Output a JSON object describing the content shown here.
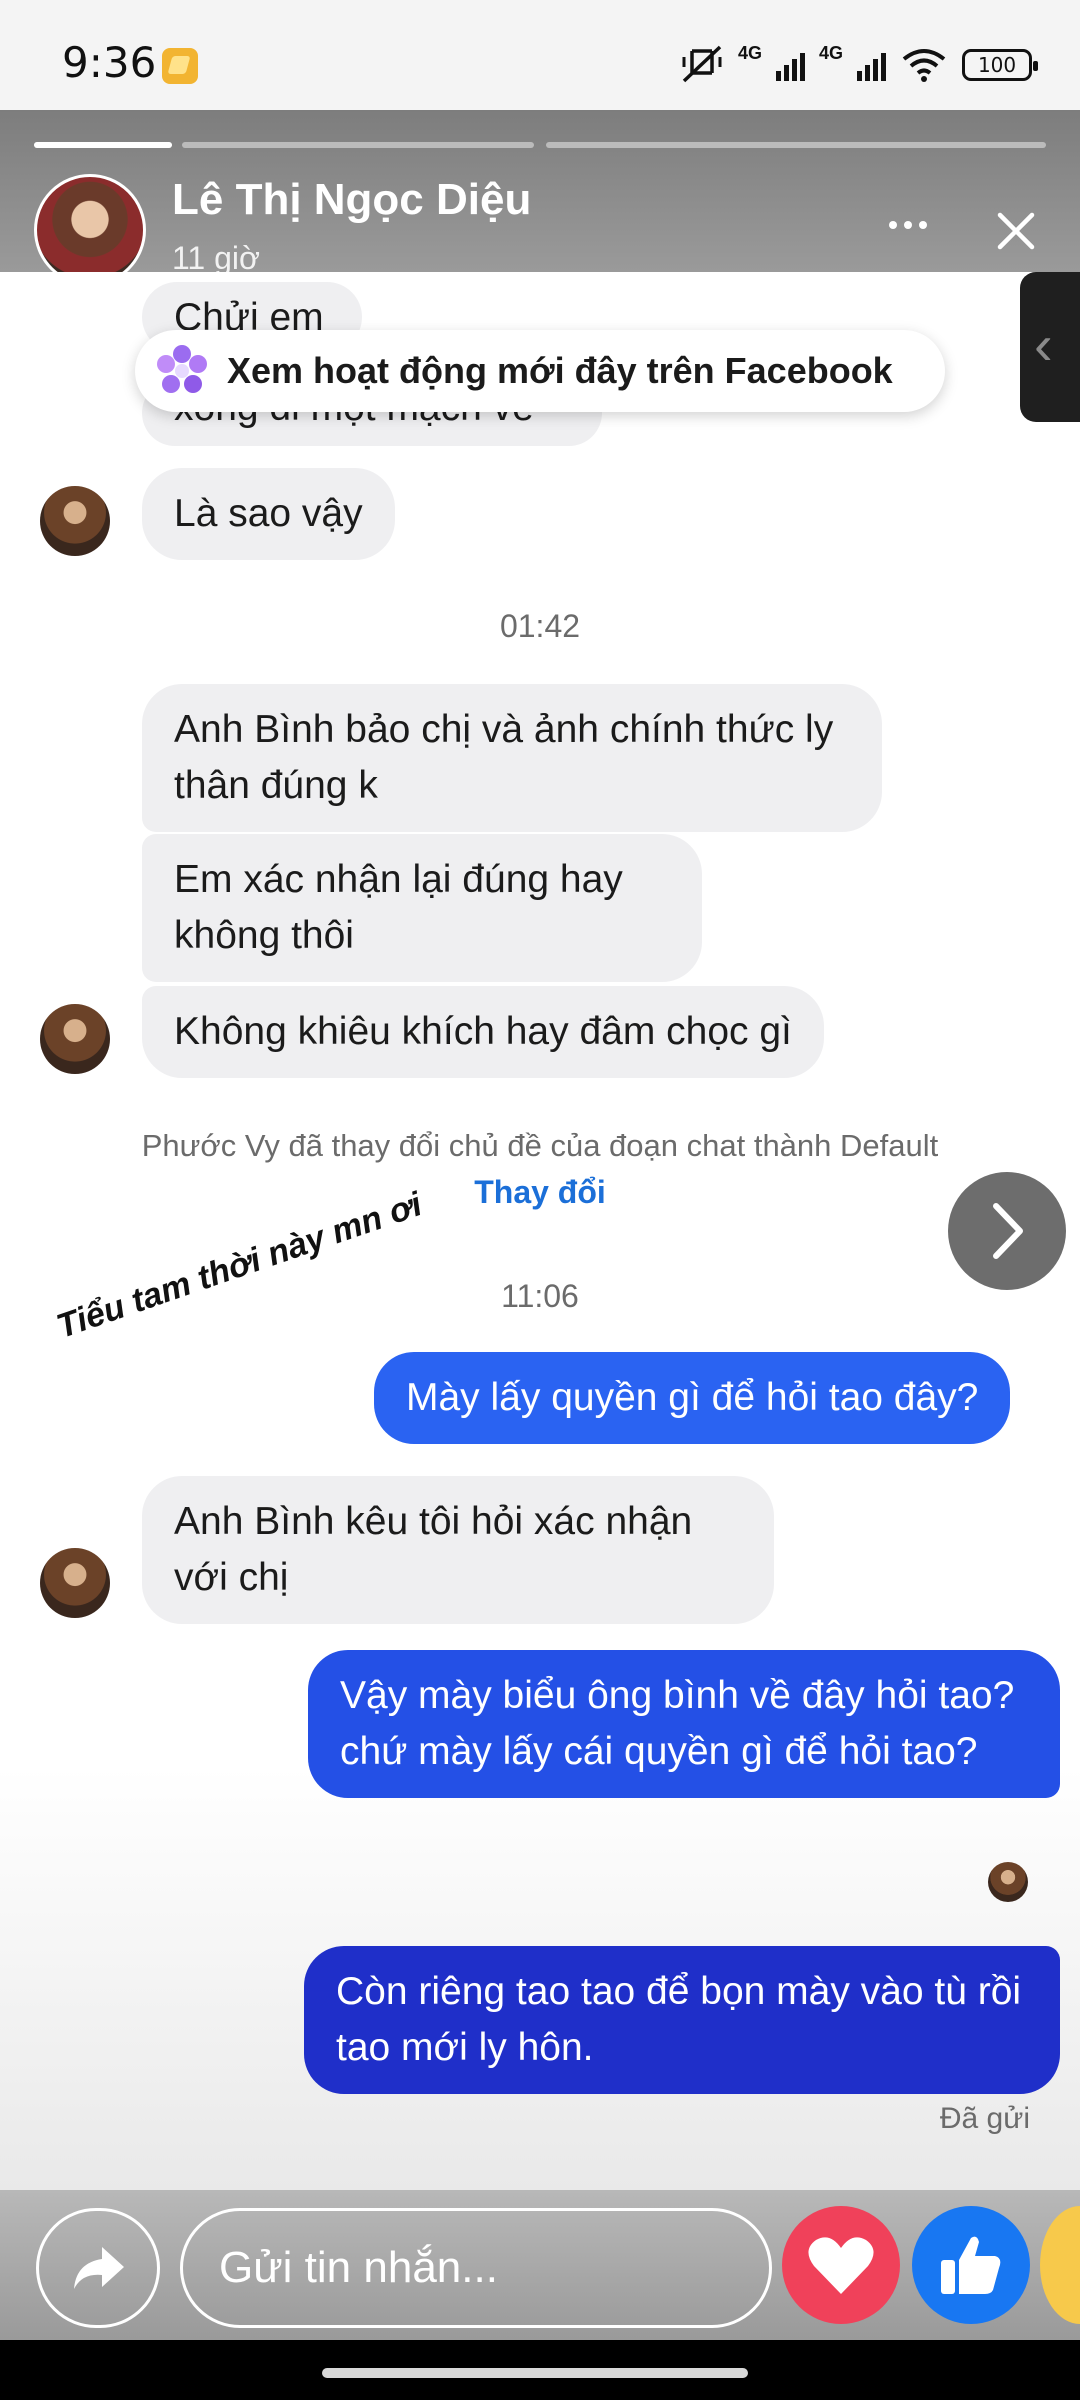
{
  "status_bar": {
    "time": "9:36",
    "network_1": "4G",
    "network_2": "4G",
    "battery": "100"
  },
  "story": {
    "name": "Lê Thị Ngọc Diệu",
    "time": "11 giờ",
    "progress": [
      1.0,
      0.0,
      0.0
    ]
  },
  "banner": {
    "text": "Xem hoạt động mới đây trên Facebook"
  },
  "chat": {
    "partial_1": "Chửi em",
    "partial_2": "xong đi một mạch về",
    "msg_1": "Là sao vậy",
    "time_1": "01:42",
    "msg_2": "Anh Bình bảo chị và ảnh chính thức ly thân đúng k",
    "msg_3": "Em xác nhận lại đúng hay không thôi",
    "msg_4": "Không khiêu khích hay đâm chọc gì",
    "system_note": "Phước Vy đã thay đổi chủ đề của đoạn chat thành Default",
    "system_link": "Thay đổi",
    "time_2": "11:06",
    "msg_5": "Mày lấy quyền gì để hỏi tao đây?",
    "msg_6": "Anh Bình kêu tôi hỏi xác nhận với chị",
    "msg_7": "Vậy mày biểu ông bình về đây hỏi tao?chứ mày lấy cái quyền gì để hỏi tao?",
    "msg_8": "Còn riêng tao tao để bọn mày vào tù rồi tao mới ly hôn.",
    "sent_status": "Đã gửi"
  },
  "sticker_text": "Tiểu tam thời này mn ơi",
  "reply": {
    "placeholder": "Gửi tin nhắn..."
  },
  "colors": {
    "accent_blue": "#1b6fd8",
    "bubble_blue_light": "#2a63f2",
    "bubble_blue_dark": "#1f2fc9",
    "heart_red": "#f0415a",
    "like_blue": "#1877f2"
  }
}
